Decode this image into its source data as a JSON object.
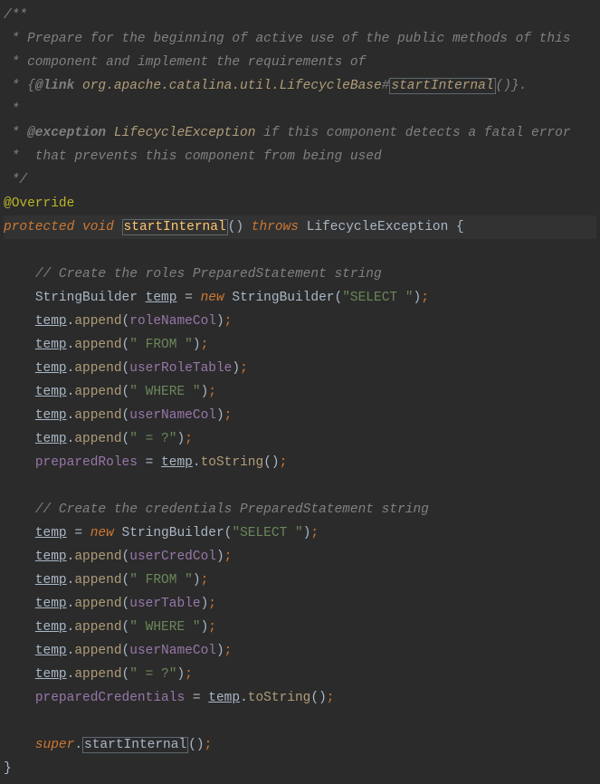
{
  "javadoc": {
    "open": "/**",
    "line1": " * Prepare for the beginning of active use of the public methods of this",
    "line2": " * component and implement the requirements of",
    "line3_star": " * {",
    "link_tag": "@link",
    "link_pkg": "org.apache.catalina.util.LifecycleBase",
    "link_hash": "#",
    "link_method": "startInternal",
    "link_end": "()}.",
    "line4": " *",
    "line5_star": " * ",
    "exc_tag": "@exception",
    "exc_type": "LifecycleException",
    "exc_rest": " if this component detects a fatal error",
    "line6": " *  that prevents this component from being used",
    "close": " */"
  },
  "code": {
    "override": "@Override",
    "protected": "protected",
    "void": "void",
    "method_name": "startInternal",
    "parens": "()",
    "throws": "throws",
    "exc": "LifecycleException",
    "lbrace": "{",
    "comment_roles": "// Create the roles PreparedStatement string",
    "sb_type": "StringBuilder",
    "temp": "temp",
    "eq": "=",
    "new": "new",
    "sb_ctor": "StringBuilder",
    "select": "\"SELECT \"",
    "append": "append",
    "roleNameCol": "roleNameCol",
    "from": "\" FROM \"",
    "userRoleTable": "userRoleTable",
    "where": "\" WHERE \"",
    "userNameCol": "userNameCol",
    "eqq": "\" = ?\"",
    "preparedRoles": "preparedRoles",
    "toString": "toString",
    "comment_creds": "// Create the credentials PreparedStatement string",
    "userCredCol": "userCredCol",
    "userTable": "userTable",
    "preparedCredentials": "preparedCredentials",
    "super": "super",
    "startInternal": "startInternal",
    "rbrace": "}"
  }
}
